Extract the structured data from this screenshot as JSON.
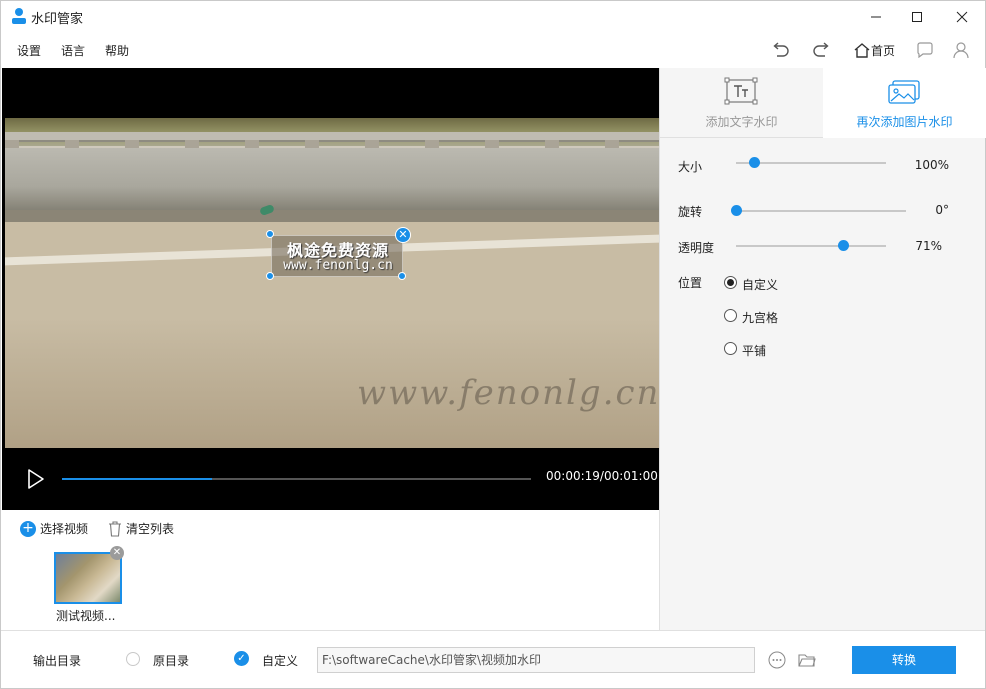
{
  "window": {
    "title": "水印管家"
  },
  "menu": {
    "settings": "设置",
    "language": "语言",
    "help": "帮助",
    "home": "首页"
  },
  "preview": {
    "watermark_line1": "枫途免费资源",
    "watermark_line2": "www.fenonlg.cn",
    "background_text": "www.fenonlg.cn"
  },
  "player": {
    "time": "00:00:19/00:01:00",
    "progress": 0.32
  },
  "filelist": {
    "add_label": "选择视频",
    "clear_label": "清空列表",
    "items": [
      {
        "name": "测试视频..."
      }
    ]
  },
  "panel": {
    "tabs": [
      {
        "label": "添加文字水印"
      },
      {
        "label": "再次添加图片水印"
      }
    ],
    "size": {
      "label": "大小",
      "value": "100%",
      "level": 0.12
    },
    "rotate": {
      "label": "旋转",
      "value": "0°",
      "level": 0.0
    },
    "opacity": {
      "label": "透明度",
      "value": "71%",
      "level": 0.71
    },
    "position": {
      "label": "位置",
      "options": [
        "自定义",
        "九宫格",
        "平铺"
      ],
      "selected": 0
    }
  },
  "bottom": {
    "output_label": "输出目录",
    "original_label": "原目录",
    "custom_label": "自定义",
    "path_value": "F:\\softwareCache\\水印管家\\视频加水印",
    "convert_label": "转换"
  },
  "colors": {
    "accent": "#1a8fe8"
  }
}
